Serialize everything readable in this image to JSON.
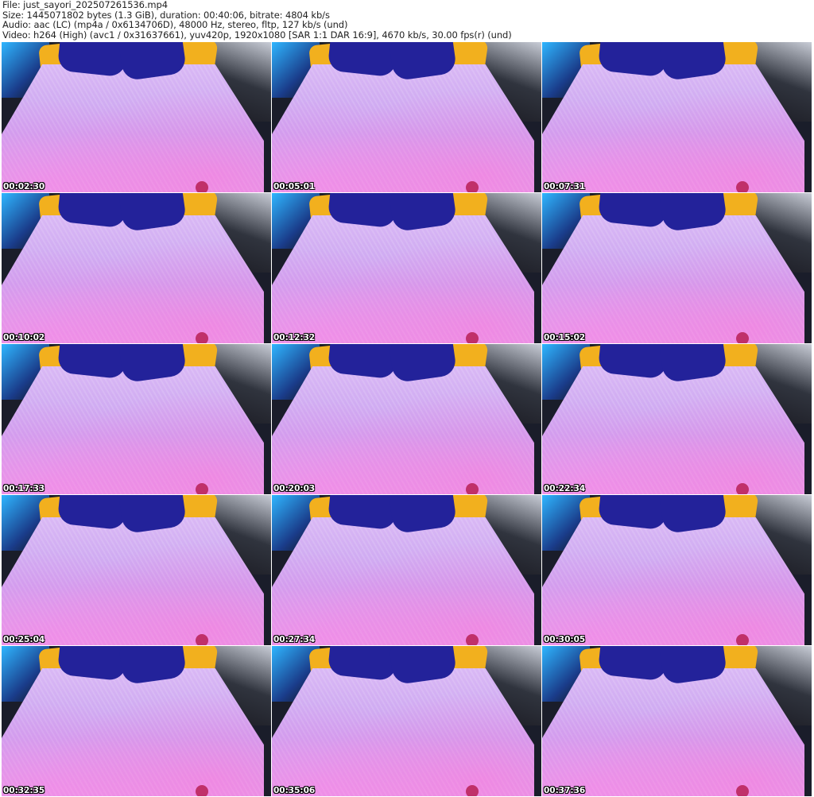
{
  "header": {
    "file": "File: just_sayori_202507261536.mp4",
    "size": "Size: 1445071802 bytes (1.3 GiB), duration: 00:40:06, bitrate: 4804 kb/s",
    "audio": "Audio: aac (LC) (mp4a / 0x6134706D), 48000 Hz, stereo, fltp, 127 kb/s (und)",
    "video": "Video: h264 (High) (avc1 / 0x31637661), yuv420p, 1920x1080 [SAR 1:1 DAR 16:9], 4670 kb/s, 30.00 fps(r) (und)"
  },
  "thumbnails": [
    "00:02:30",
    "00:05:01",
    "00:07:31",
    "00:10:02",
    "00:12:32",
    "00:15:02",
    "00:17:33",
    "00:20:03",
    "00:22:34",
    "00:25:04",
    "00:27:34",
    "00:30:05",
    "00:32:35",
    "00:35:06",
    "00:37:36"
  ]
}
